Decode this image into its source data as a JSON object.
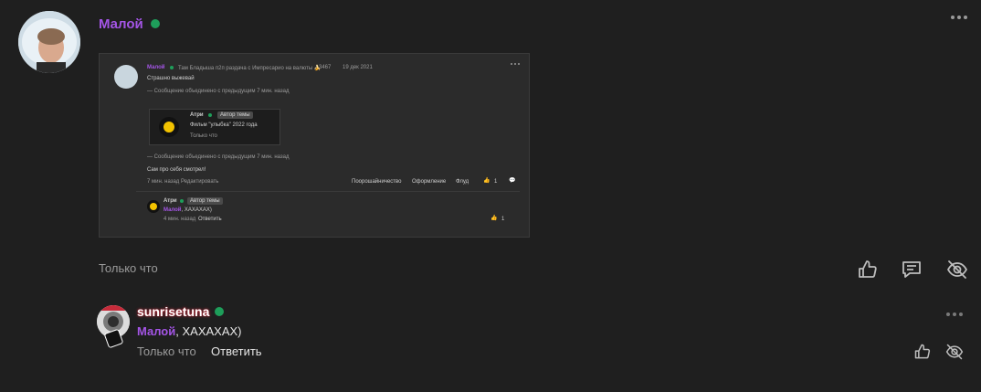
{
  "post": {
    "author": "Малой",
    "timestamp": "Только что"
  },
  "shot": {
    "author": "Малой",
    "meta": "Там Бладыша п2п раздача с Импресарио на валюты 🍌",
    "views": "3467",
    "date": "19 дек 2021",
    "text1": "Страшно выжевай",
    "merged1": "— Сообщение объединено с предыдущим 7 мин. назад",
    "quote_author": "Атри",
    "quote_tag": "Автор темы",
    "quote_text": "Фильм \"улыбка\" 2022 года",
    "quote_time": "Только что",
    "merged2": "— Сообщение объединено с предыдущим 7 мин. назад",
    "text2": "Сам про себя смотрел!",
    "post_meta": "7 мин. назад  Редактировать",
    "rate1": "Поорошайничество",
    "rate2": "Оформление",
    "rate3": "Флуд",
    "likes": "1",
    "reply_author": "Атри",
    "reply_tag": "Автор темы",
    "reply_mention": "Малой",
    "reply_text": ", ХАХАХАХ)",
    "reply_time": "4 мин. назад",
    "reply_answer": "Ответить",
    "reply_likes": "1"
  },
  "comment": {
    "author": "sunrisetuna",
    "mention": "Малой",
    "text": ", ХАХАХАХ)",
    "timestamp": "Только что",
    "reply_label": "Ответить"
  },
  "colors": {
    "accent": "#a455e6",
    "online": "#1e9e5a",
    "background": "#1f1f1f"
  }
}
